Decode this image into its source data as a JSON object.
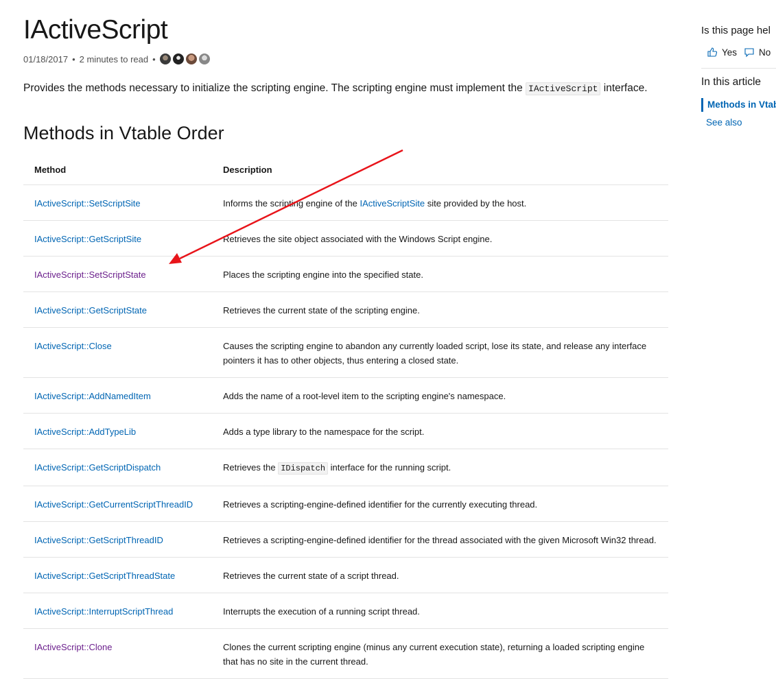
{
  "article": {
    "title": "IActiveScript",
    "date": "01/18/2017",
    "sep1": "•",
    "read_time": "2 minutes to read",
    "sep2": "•",
    "intro_before": "Provides the methods necessary to initialize the scripting engine. The scripting engine must implement the ",
    "intro_code": "IActiveScript",
    "intro_after": " interface.",
    "section_title": "Methods in Vtable Order"
  },
  "table": {
    "headers": [
      "Method",
      "Description"
    ],
    "rows": [
      {
        "method": "IActiveScript::SetScriptSite",
        "visited": false,
        "desc_before": "Informs the scripting engine of the ",
        "desc_link": "IActiveScriptSite",
        "desc_after": " site provided by the host."
      },
      {
        "method": "IActiveScript::GetScriptSite",
        "visited": false,
        "desc": "Retrieves the site object associated with the Windows Script engine."
      },
      {
        "method": "IActiveScript::SetScriptState",
        "visited": true,
        "desc": "Places the scripting engine into the specified state."
      },
      {
        "method": "IActiveScript::GetScriptState",
        "visited": false,
        "desc": "Retrieves the current state of the scripting engine."
      },
      {
        "method": "IActiveScript::Close",
        "visited": false,
        "desc": "Causes the scripting engine to abandon any currently loaded script, lose its state, and release any interface pointers it has to other objects, thus entering a closed state."
      },
      {
        "method": "IActiveScript::AddNamedItem",
        "visited": false,
        "desc": "Adds the name of a root-level item to the scripting engine's namespace."
      },
      {
        "method": "IActiveScript::AddTypeLib",
        "visited": false,
        "desc": "Adds a type library to the namespace for the script."
      },
      {
        "method": "IActiveScript::GetScriptDispatch",
        "visited": false,
        "desc_before": "Retrieves the ",
        "desc_code": "IDispatch",
        "desc_after": " interface for the running script."
      },
      {
        "method": "IActiveScript::GetCurrentScriptThreadID",
        "visited": false,
        "desc": "Retrieves a scripting-engine-defined identifier for the currently executing thread."
      },
      {
        "method": "IActiveScript::GetScriptThreadID",
        "visited": false,
        "desc": "Retrieves a scripting-engine-defined identifier for the thread associated with the given Microsoft Win32 thread."
      },
      {
        "method": "IActiveScript::GetScriptThreadState",
        "visited": false,
        "desc": "Retrieves the current state of a script thread."
      },
      {
        "method": "IActiveScript::InterruptScriptThread",
        "visited": false,
        "desc": "Interrupts the execution of a running script thread."
      },
      {
        "method": "IActiveScript::Clone",
        "visited": true,
        "desc": "Clones the current scripting engine (minus any current execution state), returning a loaded scripting engine that has no site in the current thread."
      }
    ]
  },
  "rail": {
    "helpful_question": "Is this page hel",
    "yes_label": "Yes",
    "no_label": "No",
    "toc_title": "In this article",
    "toc_items": [
      "Methods in Vtab",
      "See also"
    ]
  },
  "colors": {
    "link": "#0065b3",
    "visited_link": "#6b1f8c",
    "annotation_arrow": "#e8141a"
  },
  "icons": [
    "thumbs-up-icon",
    "feedback-icon",
    "contributor-avatar"
  ]
}
